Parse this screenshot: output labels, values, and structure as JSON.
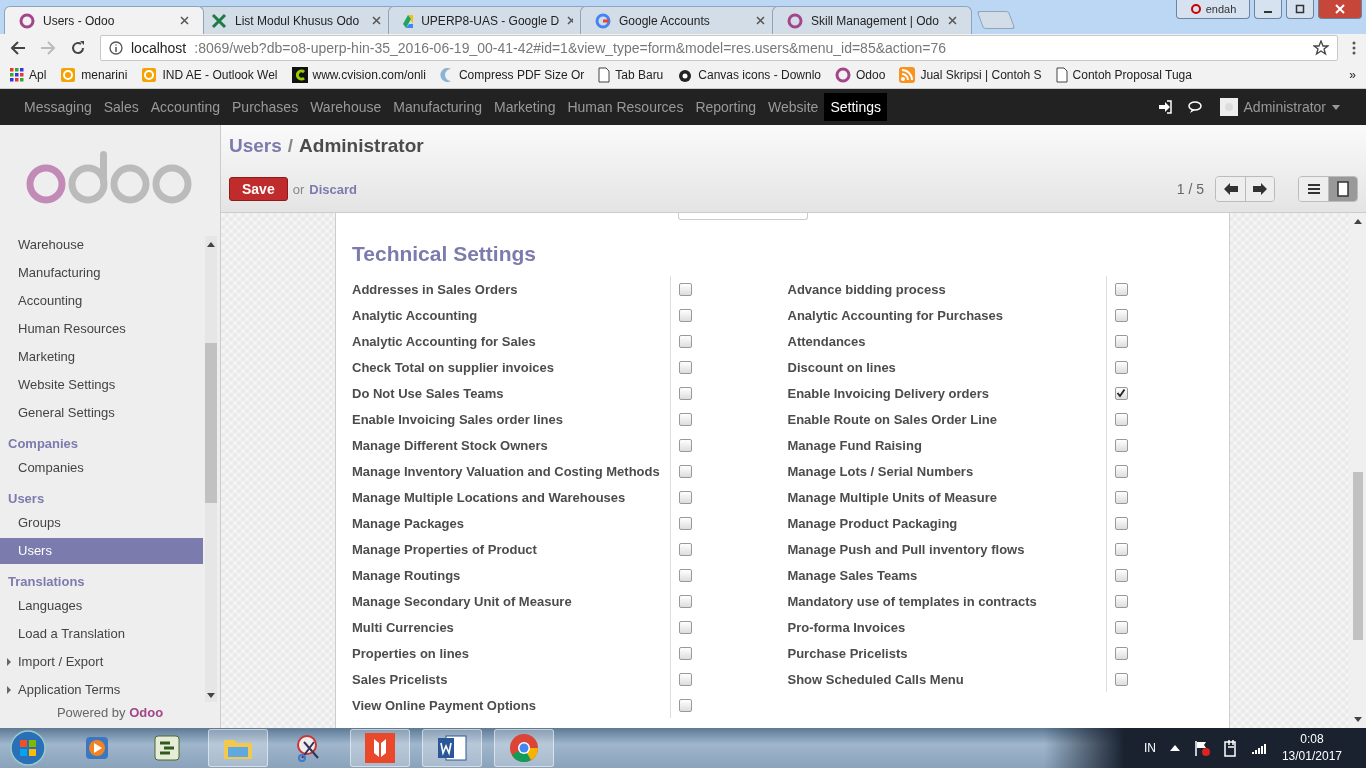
{
  "browser": {
    "tabs": [
      {
        "title": "Users - Odoo",
        "kind": "odoo",
        "selected": true
      },
      {
        "title": "List Modul Khusus Odo",
        "kind": "sheet",
        "selected": false
      },
      {
        "title": "UPERP8-UAS - Google D",
        "kind": "drive",
        "selected": false
      },
      {
        "title": "Google Accounts",
        "kind": "google",
        "selected": false
      },
      {
        "title": "Skill Management | Odo",
        "kind": "odoo",
        "selected": false
      }
    ],
    "profile": "endah",
    "url_host": "localhost",
    "url_rest": ":8069/web?db=o8-uperp-hin-35_2016-06-19_00-41-42#id=1&view_type=form&model=res.users&menu_id=85&action=76",
    "bookmarks": [
      {
        "label": "Apl",
        "kind": "apps"
      },
      {
        "label": "menarini",
        "kind": "outlook"
      },
      {
        "label": "IND AE - Outlook Wel",
        "kind": "outlook"
      },
      {
        "label": "www.cvision.com/onli",
        "kind": "cvision"
      },
      {
        "label": "Compress PDF Size Or",
        "kind": "compress"
      },
      {
        "label": "Tab Baru",
        "kind": "page"
      },
      {
        "label": "Canvas icons - Downlo",
        "kind": "canvas"
      },
      {
        "label": "Odoo",
        "kind": "odoo"
      },
      {
        "label": "Jual Skripsi | Contoh S",
        "kind": "rss"
      },
      {
        "label": "Contoh Proposal Tuga",
        "kind": "page"
      }
    ],
    "more": "»"
  },
  "menu": {
    "items": [
      {
        "label": "Messaging",
        "selected": false
      },
      {
        "label": "Sales",
        "selected": false
      },
      {
        "label": "Accounting",
        "selected": false
      },
      {
        "label": "Purchases",
        "selected": false
      },
      {
        "label": "Warehouse",
        "selected": false
      },
      {
        "label": "Manufacturing",
        "selected": false
      },
      {
        "label": "Marketing",
        "selected": false
      },
      {
        "label": "Human Resources",
        "selected": false
      },
      {
        "label": "Reporting",
        "selected": false
      },
      {
        "label": "Website",
        "selected": false
      },
      {
        "label": "Settings",
        "selected": true
      }
    ],
    "user": "Administrator"
  },
  "sidebar": {
    "sections": [
      {
        "items": [
          {
            "label": "Warehouse",
            "selected": false
          },
          {
            "label": "Manufacturing",
            "selected": false
          },
          {
            "label": "Accounting",
            "selected": false
          },
          {
            "label": "Human Resources",
            "selected": false
          },
          {
            "label": "Marketing",
            "selected": false
          },
          {
            "label": "Website Settings",
            "selected": false
          },
          {
            "label": "General Settings",
            "selected": false
          }
        ]
      },
      {
        "heading": "Companies",
        "items": [
          {
            "label": "Companies",
            "selected": false
          }
        ]
      },
      {
        "heading": "Users",
        "items": [
          {
            "label": "Groups",
            "selected": false
          },
          {
            "label": "Users",
            "selected": true
          }
        ]
      },
      {
        "heading": "Translations",
        "items": [
          {
            "label": "Languages",
            "selected": false
          },
          {
            "label": "Load a Translation",
            "selected": false
          },
          {
            "label": "Import / Export",
            "selected": false,
            "expanded": false
          },
          {
            "label": "Application Terms",
            "selected": false,
            "expanded": false
          }
        ]
      }
    ],
    "powered_by": "Powered by",
    "powered_brand": "Odoo"
  },
  "header": {
    "breadcrumb": "Users",
    "separator": "/",
    "title": "Administrator",
    "save": "Save",
    "or": "or",
    "discard": "Discard",
    "pager": "1 / 5",
    "view_buttons": [
      {
        "kind": "list",
        "selected": false
      },
      {
        "kind": "form",
        "selected": true
      }
    ]
  },
  "settings": {
    "title": "Technical Settings",
    "left": [
      {
        "label": "Addresses in Sales Orders",
        "checked": false
      },
      {
        "label": "Analytic Accounting",
        "checked": false
      },
      {
        "label": "Analytic Accounting for Sales",
        "checked": false
      },
      {
        "label": "Check Total on supplier invoices",
        "checked": false
      },
      {
        "label": "Do Not Use Sales Teams",
        "checked": false
      },
      {
        "label": "Enable Invoicing Sales order lines",
        "checked": false
      },
      {
        "label": "Manage Different Stock Owners",
        "checked": false
      },
      {
        "label": "Manage Inventory Valuation and Costing Methods",
        "checked": false
      },
      {
        "label": "Manage Multiple Locations and Warehouses",
        "checked": false
      },
      {
        "label": "Manage Packages",
        "checked": false
      },
      {
        "label": "Manage Properties of Product",
        "checked": false
      },
      {
        "label": "Manage Routings",
        "checked": false
      },
      {
        "label": "Manage Secondary Unit of Measure",
        "checked": false
      },
      {
        "label": "Multi Currencies",
        "checked": false
      },
      {
        "label": "Properties on lines",
        "checked": false
      },
      {
        "label": "Sales Pricelists",
        "checked": false
      },
      {
        "label": "View Online Payment Options",
        "checked": false
      }
    ],
    "right": [
      {
        "label": "Advance bidding process",
        "checked": false
      },
      {
        "label": "Analytic Accounting for Purchases",
        "checked": false
      },
      {
        "label": "Attendances",
        "checked": false
      },
      {
        "label": "Discount on lines",
        "checked": false
      },
      {
        "label": "Enable Invoicing Delivery orders",
        "checked": true
      },
      {
        "label": "Enable Route on Sales Order Line",
        "checked": false
      },
      {
        "label": "Manage Fund Raising",
        "checked": false
      },
      {
        "label": "Manage Lots / Serial Numbers",
        "checked": false
      },
      {
        "label": "Manage Multiple Units of Measure",
        "checked": false
      },
      {
        "label": "Manage Product Packaging",
        "checked": false
      },
      {
        "label": "Manage Push and Pull inventory flows",
        "checked": false
      },
      {
        "label": "Manage Sales Teams",
        "checked": false
      },
      {
        "label": "Mandatory use of templates in contracts",
        "checked": false
      },
      {
        "label": "Pro-forma Invoices",
        "checked": false
      },
      {
        "label": "Purchase Pricelists",
        "checked": false
      },
      {
        "label": "Show Scheduled Calls Menu",
        "checked": false
      }
    ]
  },
  "taskbar": {
    "apps": [
      {
        "kind": "media",
        "active": false
      },
      {
        "kind": "project",
        "active": false
      },
      {
        "kind": "folder",
        "active": true
      },
      {
        "kind": "scissors",
        "active": false
      },
      {
        "kind": "pdf",
        "active": true
      },
      {
        "kind": "word",
        "active": true
      },
      {
        "kind": "chrome",
        "active": true
      }
    ],
    "language": "IN",
    "time": "0:08",
    "date": "13/01/2017"
  }
}
